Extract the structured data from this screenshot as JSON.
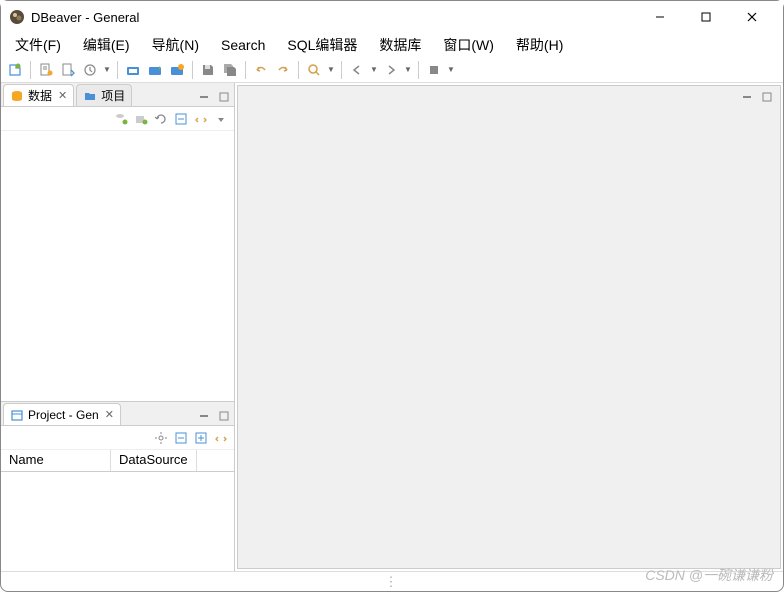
{
  "window": {
    "title": "DBeaver - General"
  },
  "menu": {
    "file": "文件(F)",
    "edit": "编辑(E)",
    "navigate": "导航(N)",
    "search": "Search",
    "sql_editor": "SQL编辑器",
    "database": "数据库",
    "window": "窗口(W)",
    "help": "帮助(H)"
  },
  "left_panel": {
    "tabs": {
      "data": "数据",
      "projects": "项目"
    }
  },
  "project_panel": {
    "tab": "Project - Gen",
    "columns": {
      "name": "Name",
      "datasource": "DataSource"
    }
  },
  "watermark": "CSDN @一碗谦谦粉"
}
